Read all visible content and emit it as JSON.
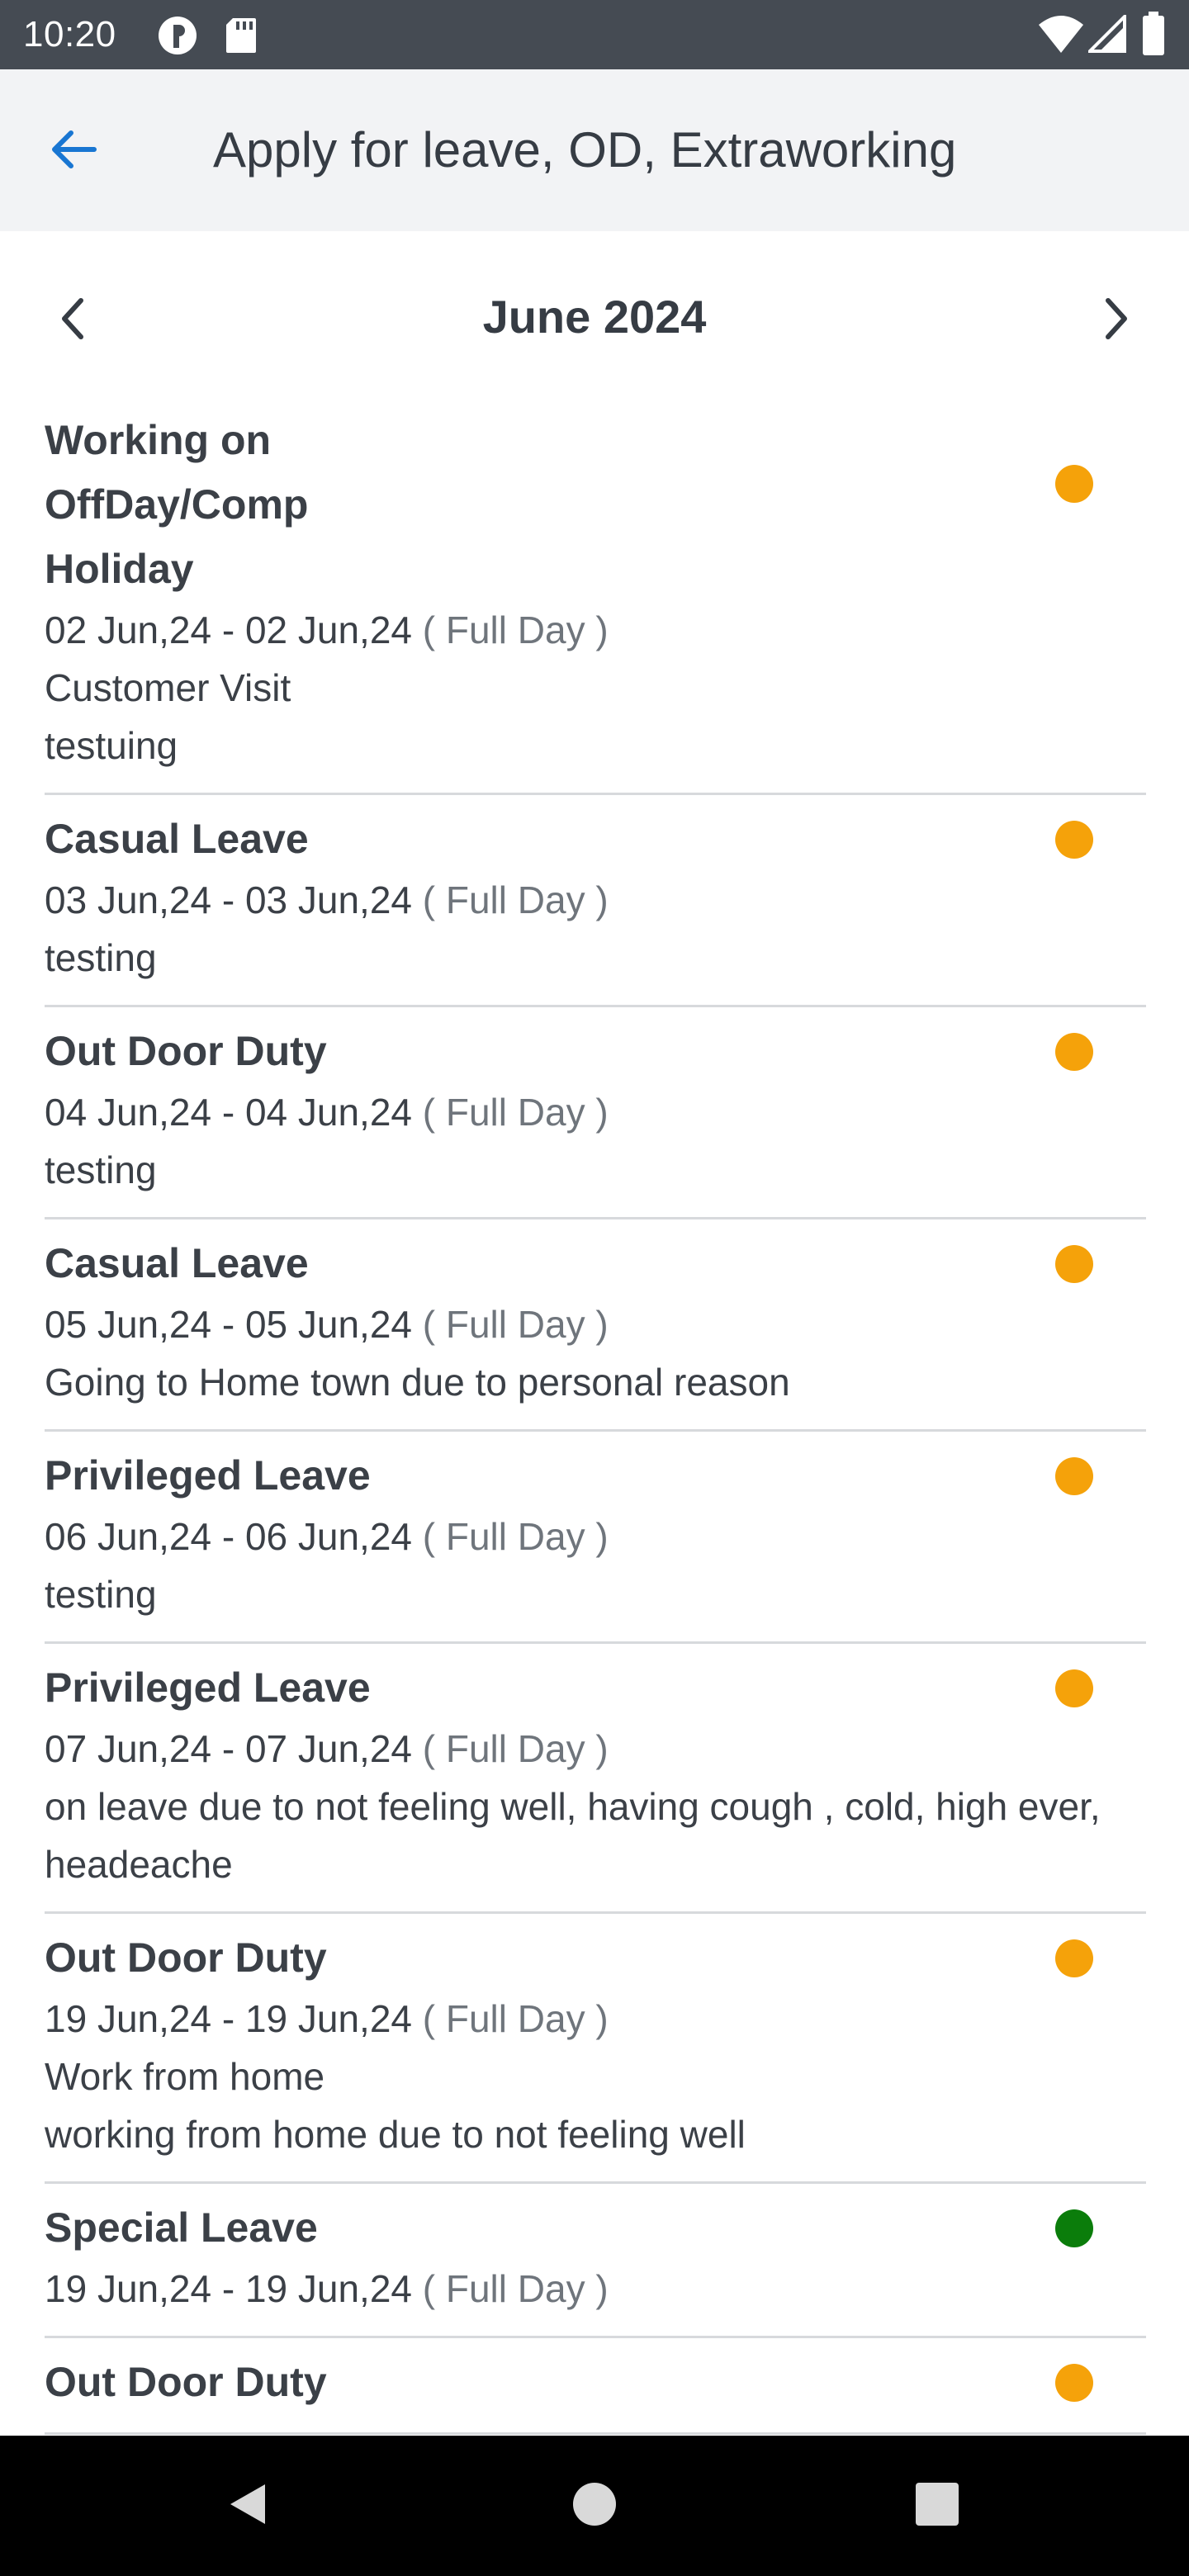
{
  "status_bar": {
    "time": "10:20",
    "icons": [
      "app-notification-icon",
      "sd-card-icon",
      "wifi-icon",
      "signal-icon",
      "battery-icon"
    ]
  },
  "app_bar": {
    "title": "Apply for leave, OD, Extraworking",
    "back_icon": "arrow-left-icon"
  },
  "month_nav": {
    "label": "June 2024",
    "prev_icon": "chevron-left-icon",
    "next_icon": "chevron-right-icon"
  },
  "colors": {
    "accent": "#1976d2",
    "pending": "#f5a20a",
    "approved": "#0b7d0b",
    "status_bar": "#454b53",
    "app_bar": "#f2f3f5"
  },
  "items": [
    {
      "type": "Working on OffDay/Comp Holiday",
      "dates": "02 Jun,24 - 02 Jun,24",
      "duration": "( Full Day )",
      "reasons": [
        "Customer Visit",
        "testuing"
      ],
      "status": "pending"
    },
    {
      "type": "Casual Leave",
      "dates": "03 Jun,24 - 03 Jun,24",
      "duration": "( Full Day )",
      "reasons": [
        "testing"
      ],
      "status": "pending"
    },
    {
      "type": "Out Door Duty",
      "dates": "04 Jun,24 - 04 Jun,24",
      "duration": "( Full Day )",
      "reasons": [
        "testing"
      ],
      "status": "pending"
    },
    {
      "type": "Casual Leave",
      "dates": "05 Jun,24 - 05 Jun,24",
      "duration": "( Full Day )",
      "reasons": [
        "Going to Home town due to personal reason"
      ],
      "status": "pending"
    },
    {
      "type": "Privileged Leave",
      "dates": "06 Jun,24 - 06 Jun,24",
      "duration": "( Full Day )",
      "reasons": [
        "testing"
      ],
      "status": "pending"
    },
    {
      "type": "Privileged Leave",
      "dates": "07 Jun,24 - 07 Jun,24",
      "duration": "( Full Day )",
      "reasons": [
        "on leave due to not feeling well, having cough , cold, high ever, headeache"
      ],
      "status": "pending"
    },
    {
      "type": "Out Door Duty",
      "dates": "19 Jun,24 - 19 Jun,24",
      "duration": "( Full Day )",
      "reasons": [
        "Work from home",
        "working from home due to not feeling well"
      ],
      "status": "pending"
    },
    {
      "type": "Special Leave",
      "dates": "19 Jun,24 - 19 Jun,24",
      "duration": "( Full Day )",
      "reasons": [],
      "status": "approved"
    },
    {
      "type": "Out Door Duty",
      "dates": "",
      "duration": "",
      "reasons": [],
      "status": "pending"
    }
  ],
  "nav_bar": {
    "icons": [
      "back-triangle-icon",
      "home-circle-icon",
      "recents-square-icon"
    ]
  }
}
